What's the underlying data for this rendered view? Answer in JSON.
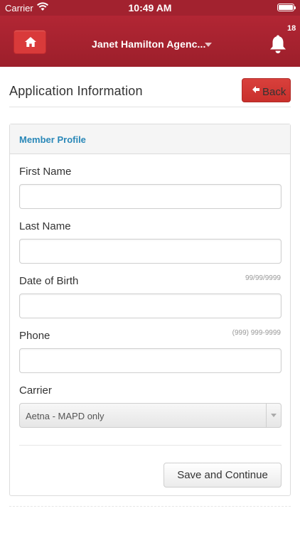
{
  "status_bar": {
    "carrier": "Carrier",
    "time": "10:49 AM"
  },
  "nav": {
    "agency": "Janet Hamilton Agenc...",
    "notification_count": "18",
    "icons": {
      "home": "home-icon",
      "bell": "bell-icon",
      "caret": "caret-down-icon"
    }
  },
  "page": {
    "title": "Application Information",
    "back_label": "Back"
  },
  "panel": {
    "heading": "Member Profile"
  },
  "form": {
    "first_name_label": "First Name",
    "first_name_value": "",
    "last_name_label": "Last Name",
    "last_name_value": "",
    "dob_label": "Date of Birth",
    "dob_hint": "99/99/9999",
    "dob_value": "",
    "phone_label": "Phone",
    "phone_hint": "(999) 999-9999",
    "phone_value": "",
    "carrier_label": "Carrier",
    "carrier_selected": "Aetna - MAPD only",
    "save_label": "Save and Continue"
  },
  "colors": {
    "brand": "#a2222f",
    "danger": "#d9403c",
    "link": "#2a88b8"
  }
}
